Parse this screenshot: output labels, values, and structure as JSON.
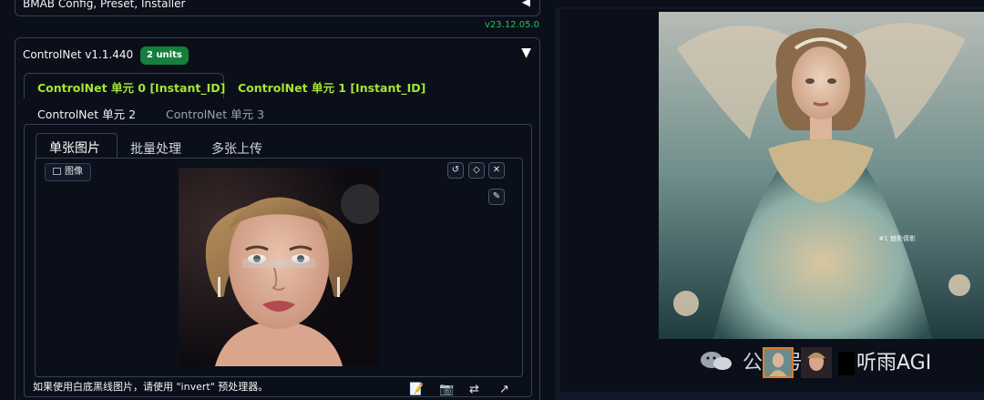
{
  "bmab": {
    "title": "BMAB Config, Preset, Installer",
    "arrow": "◀"
  },
  "version": "v23.12.05.0",
  "controlnet": {
    "title": "ControlNet v1.1.440",
    "badge": "2 units",
    "toggle": "▼",
    "unit_tabs": [
      {
        "label": "ControlNet 单元 0 [Instant_ID]"
      },
      {
        "label": "ControlNet 单元 1 [Instant_ID]"
      },
      {
        "label": "ControlNet 单元 2"
      },
      {
        "label": "ControlNet 单元 3"
      }
    ],
    "image_tabs": [
      {
        "label": "单张图片"
      },
      {
        "label": "批量处理"
      },
      {
        "label": "多张上传"
      }
    ],
    "image_label": "图像",
    "hint": "如果使用白底黑线图片，请使用 \"invert\" 预处理器。",
    "image_buttons": [
      "undo-icon",
      "eraser-icon",
      "close-icon",
      "brush-icon"
    ],
    "bottom_icons": [
      "edit-icon",
      "camera-icon",
      "swap-icon",
      "arrow-icon"
    ]
  },
  "output": {
    "image_tag": "#1 魅影倩影"
  },
  "watermark": {
    "text_left": "公众号·",
    "text_right": "听雨AGI"
  },
  "colors": {
    "accent_green": "#a3e635",
    "badge_green": "#15803d",
    "version_green": "#22c55e",
    "bg": "#0b0f19"
  }
}
